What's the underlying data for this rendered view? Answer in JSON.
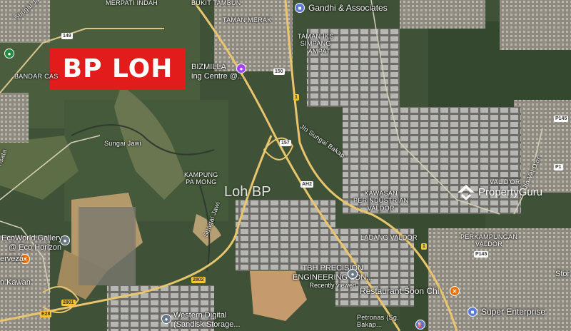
{
  "banner": {
    "title": "BP LOH"
  },
  "watermark": "Loh BP",
  "brand_logo": {
    "name": "PropertyGuru",
    "icon": "propertyguru-logo-icon"
  },
  "areas": {
    "merpati_indah": "MERPATI INDAH",
    "bukit_tambun": "BUKIT TAMBUN",
    "taman_merak": "TAMAN MERAK",
    "taman_iks_1": "TAMAN IKS",
    "taman_iks_2": "SIMPANG",
    "taman_iks_3": "AMPAT",
    "bandar_cas": "BANDAR CAS",
    "kampung_1": "KAMPUNG",
    "kampung_2": "PA MONG",
    "kawasan_1": "KAWASAN",
    "kawasan_2": "PERINDUSTRIAN",
    "kawasan_3": "VALDOR",
    "ladang": "LADANG VALDOR",
    "val_dor": "VAL D'OR",
    "perkampungan_1": "PERKAMPUNGAN",
    "perkampungan_2": "VALDOR",
    "kawan": "n Kawan",
    "stor": "Stor"
  },
  "roads": {
    "sungai_jawi_1": "Sungai Jawi",
    "sungai_jawi_2": "Sungai Jawi",
    "sungai_ja": "Sungai Ja",
    "jalan_sungai_bakap": "Jln Sungai Bakap",
    "jalan_valdor": "Jln Val D'or",
    "sungai_kerian": "nsata"
  },
  "route_tags": {
    "r149": "149",
    "r150": "150",
    "r1a": "1",
    "r157": "157",
    "ah2": "AH2",
    "r1b": "1",
    "p145a": "P145",
    "p145b": "P145",
    "p1": "P1",
    "e2802": "2802",
    "e2801": "2801",
    "e28": "E28"
  },
  "pois": {
    "gandhi": {
      "name": "Gandhi & Associates",
      "icon": "office-icon"
    },
    "bizmilla": {
      "name": "BIZMILLA",
      "sub": "ing Centre @...",
      "icon": "shopping-icon"
    },
    "ecoworld": {
      "name": "EcoWorld Gallery",
      "sub": "@ Eco Horizon",
      "icon": "gallery-icon"
    },
    "tbh": {
      "name": "TBH PRECISION",
      "sub": "ENGINEERING SDN...",
      "sub2": "Recently viewed",
      "icon": "factory-icon"
    },
    "restaurant": {
      "name": "Restaurant Soon Chi",
      "icon": "restaurant-icon"
    },
    "super": {
      "name": "Super Enterprise",
      "icon": "store-icon"
    },
    "western": {
      "name": "Western Digital",
      "sub": "(Sandisk Storage...",
      "icon": "factory-icon"
    },
    "petronas": {
      "name": "Petronas (Sg.",
      "sub": "Bakap...",
      "icon": "fuel-icon"
    },
    "cerveza": {
      "name": "erveza",
      "icon": "restaurant-icon"
    }
  }
}
